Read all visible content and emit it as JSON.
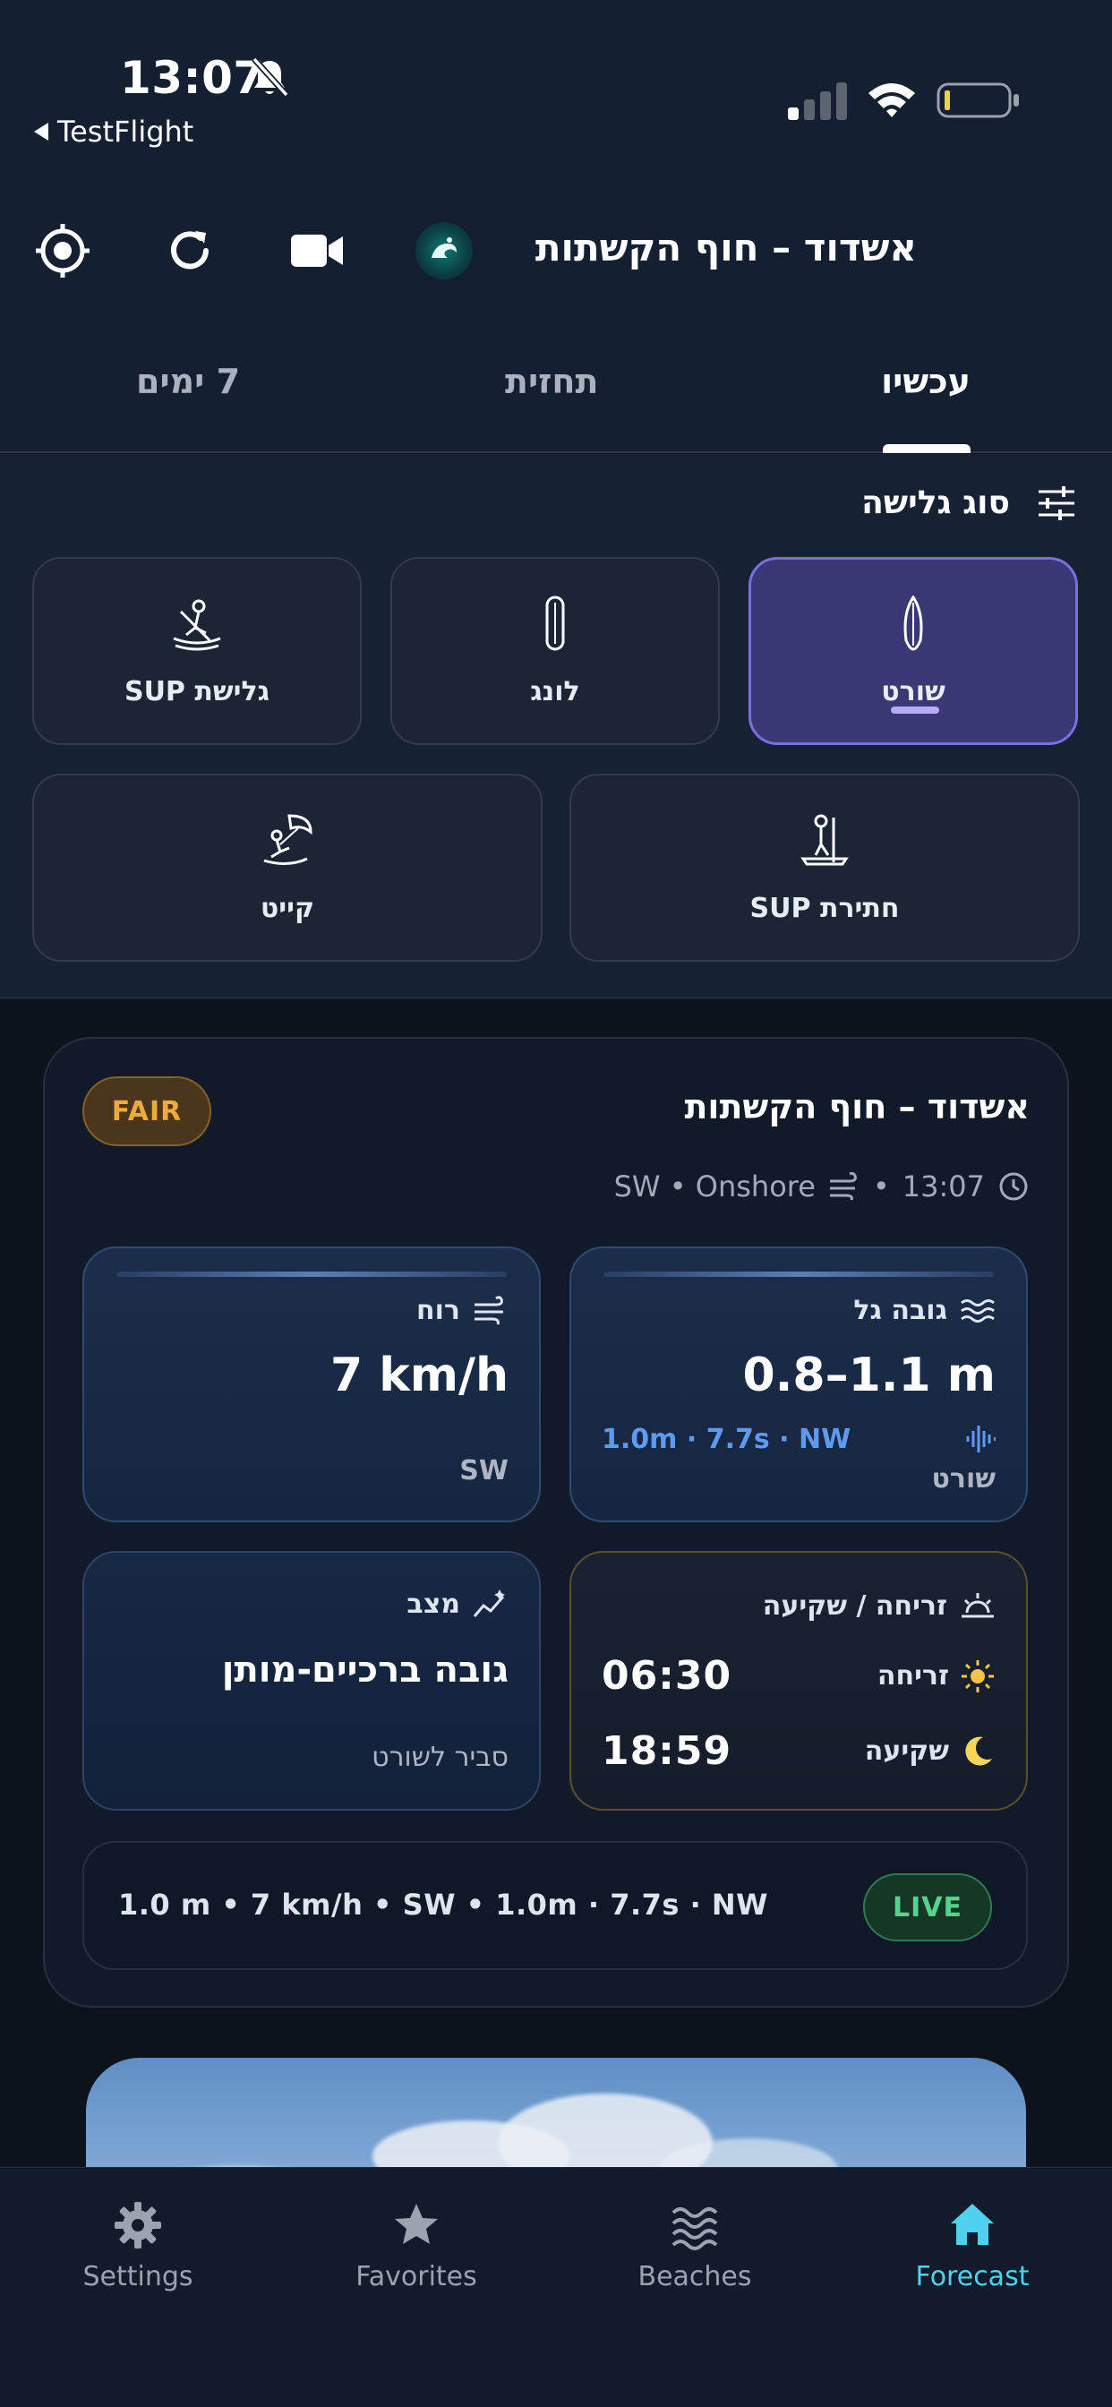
{
  "status_bar": {
    "time": "13:07",
    "back_app": "TestFlight"
  },
  "header": {
    "beach_name": "אשדוד – חוף הקשתות"
  },
  "tabs": {
    "now": "עכשיו",
    "forecast": "תחזית",
    "days7": "7 ימים"
  },
  "surf_types": {
    "title": "סוג גלישה",
    "short": "שורט",
    "long": "לונג",
    "sup_surf": "גלישת SUP",
    "sup_foil": "חתירת SUP",
    "kite": "קייט"
  },
  "card": {
    "rating": "FAIR",
    "beach_name": "אשדוד – חוף הקשתות",
    "time": "13:07",
    "wind_meta": "SW • Onshore",
    "wave": {
      "label": "גובה גל",
      "value": "0.8–1.1 m",
      "swell": "1.0m · 7.7s · NW",
      "board": "שורט"
    },
    "wind": {
      "label": "רוח",
      "value": "7 km/h",
      "direction": "SW"
    },
    "sun": {
      "label": "זריחה / שקיעה",
      "sunrise_label": "זריחה",
      "sunrise": "06:30",
      "sunset_label": "שקיעה",
      "sunset": "18:59"
    },
    "state": {
      "label": "מצב",
      "value": "גובה ברכיים-מותן",
      "note": "סביר לשורט"
    },
    "live_summary": "1.0 m • 7 km/h • SW • 1.0m · 7.7s · NW",
    "live_badge": "LIVE"
  },
  "nav": {
    "settings": "Settings",
    "favorites": "Favorites",
    "beaches": "Beaches",
    "forecast": "Forecast"
  },
  "colors": {
    "accent": "#4fd2ef",
    "fair": "#f0a93a",
    "live": "#52d489",
    "selected": "#7b6ee0",
    "swell": "#5e9bf0"
  }
}
